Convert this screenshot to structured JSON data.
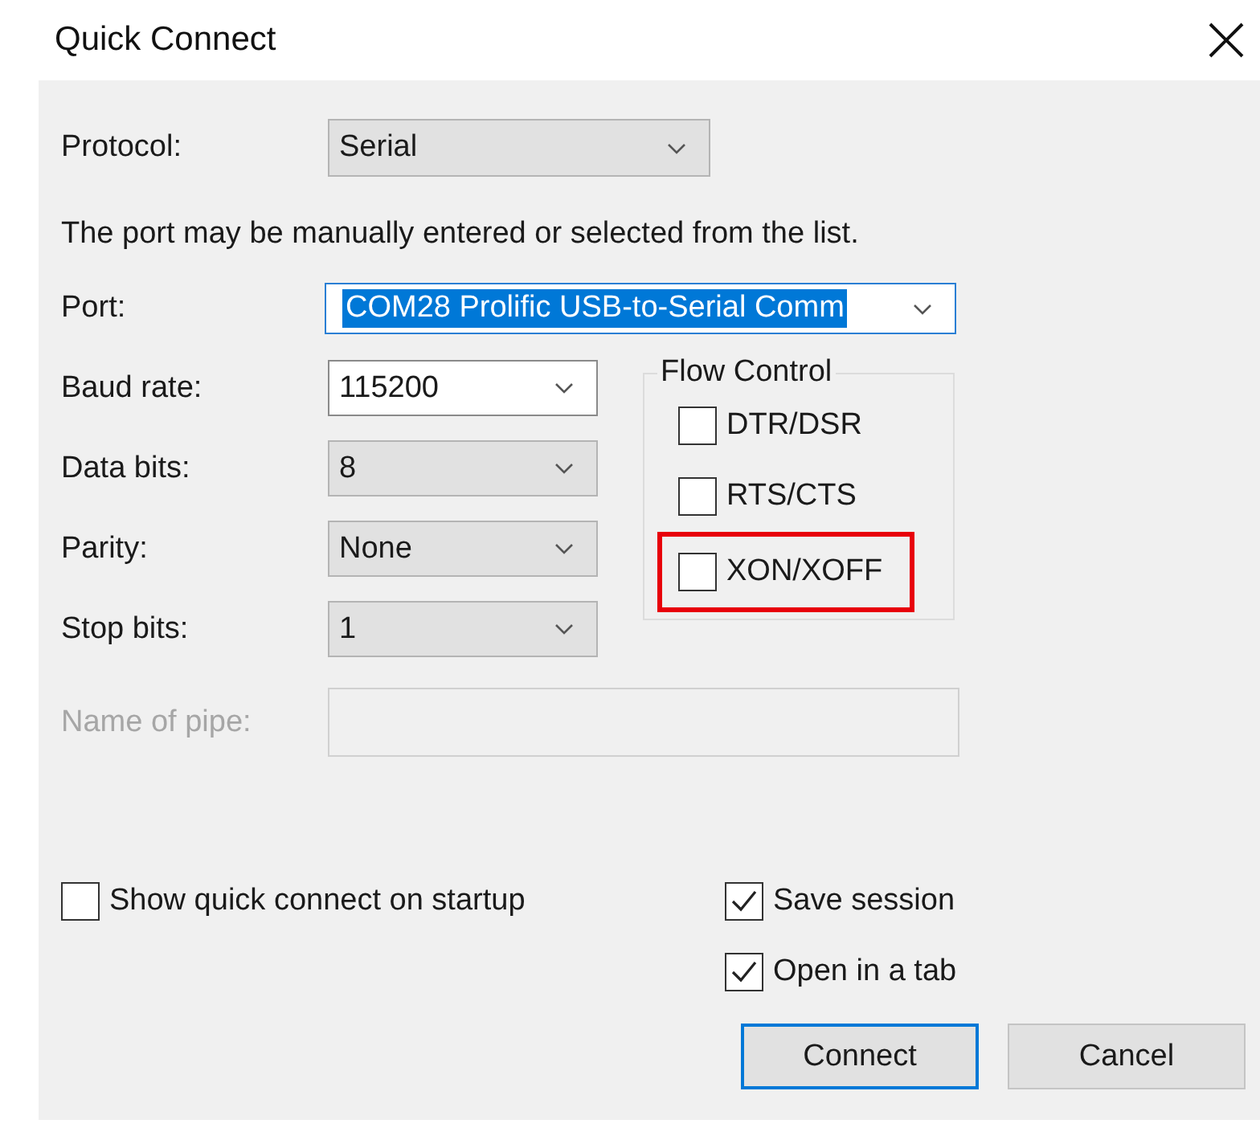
{
  "window": {
    "title": "Quick Connect"
  },
  "protocol": {
    "label": "Protocol:",
    "value": "Serial",
    "editable": false
  },
  "hint": "The port may be manually entered or selected from the list.",
  "port": {
    "label": "Port:",
    "value": "COM28 Prolific USB-to-Serial Comm",
    "editable": true,
    "text_selected": true
  },
  "settings": [
    {
      "label": "Baud rate:",
      "value": "115200",
      "editable": true
    },
    {
      "label": "Data bits:",
      "value": "8",
      "editable": false
    },
    {
      "label": "Parity:",
      "value": "None",
      "editable": false
    },
    {
      "label": "Stop bits:",
      "value": "1",
      "editable": false
    }
  ],
  "flow_control": {
    "title": "Flow Control",
    "options": [
      {
        "label": "DTR/DSR",
        "checked": false,
        "highlighted": false
      },
      {
        "label": "RTS/CTS",
        "checked": false,
        "highlighted": false
      },
      {
        "label": "XON/XOFF",
        "checked": false,
        "highlighted": true
      }
    ]
  },
  "pipe": {
    "label": "Name of pipe:",
    "disabled": true
  },
  "left_options": [
    {
      "label": "Show quick connect on startup",
      "checked": false
    }
  ],
  "right_options": [
    {
      "label": "Save session",
      "checked": true
    },
    {
      "label": "Open in a tab",
      "checked": true
    }
  ],
  "buttons": [
    {
      "label": "Connect",
      "default": true
    },
    {
      "label": "Cancel",
      "default": false
    }
  ]
}
